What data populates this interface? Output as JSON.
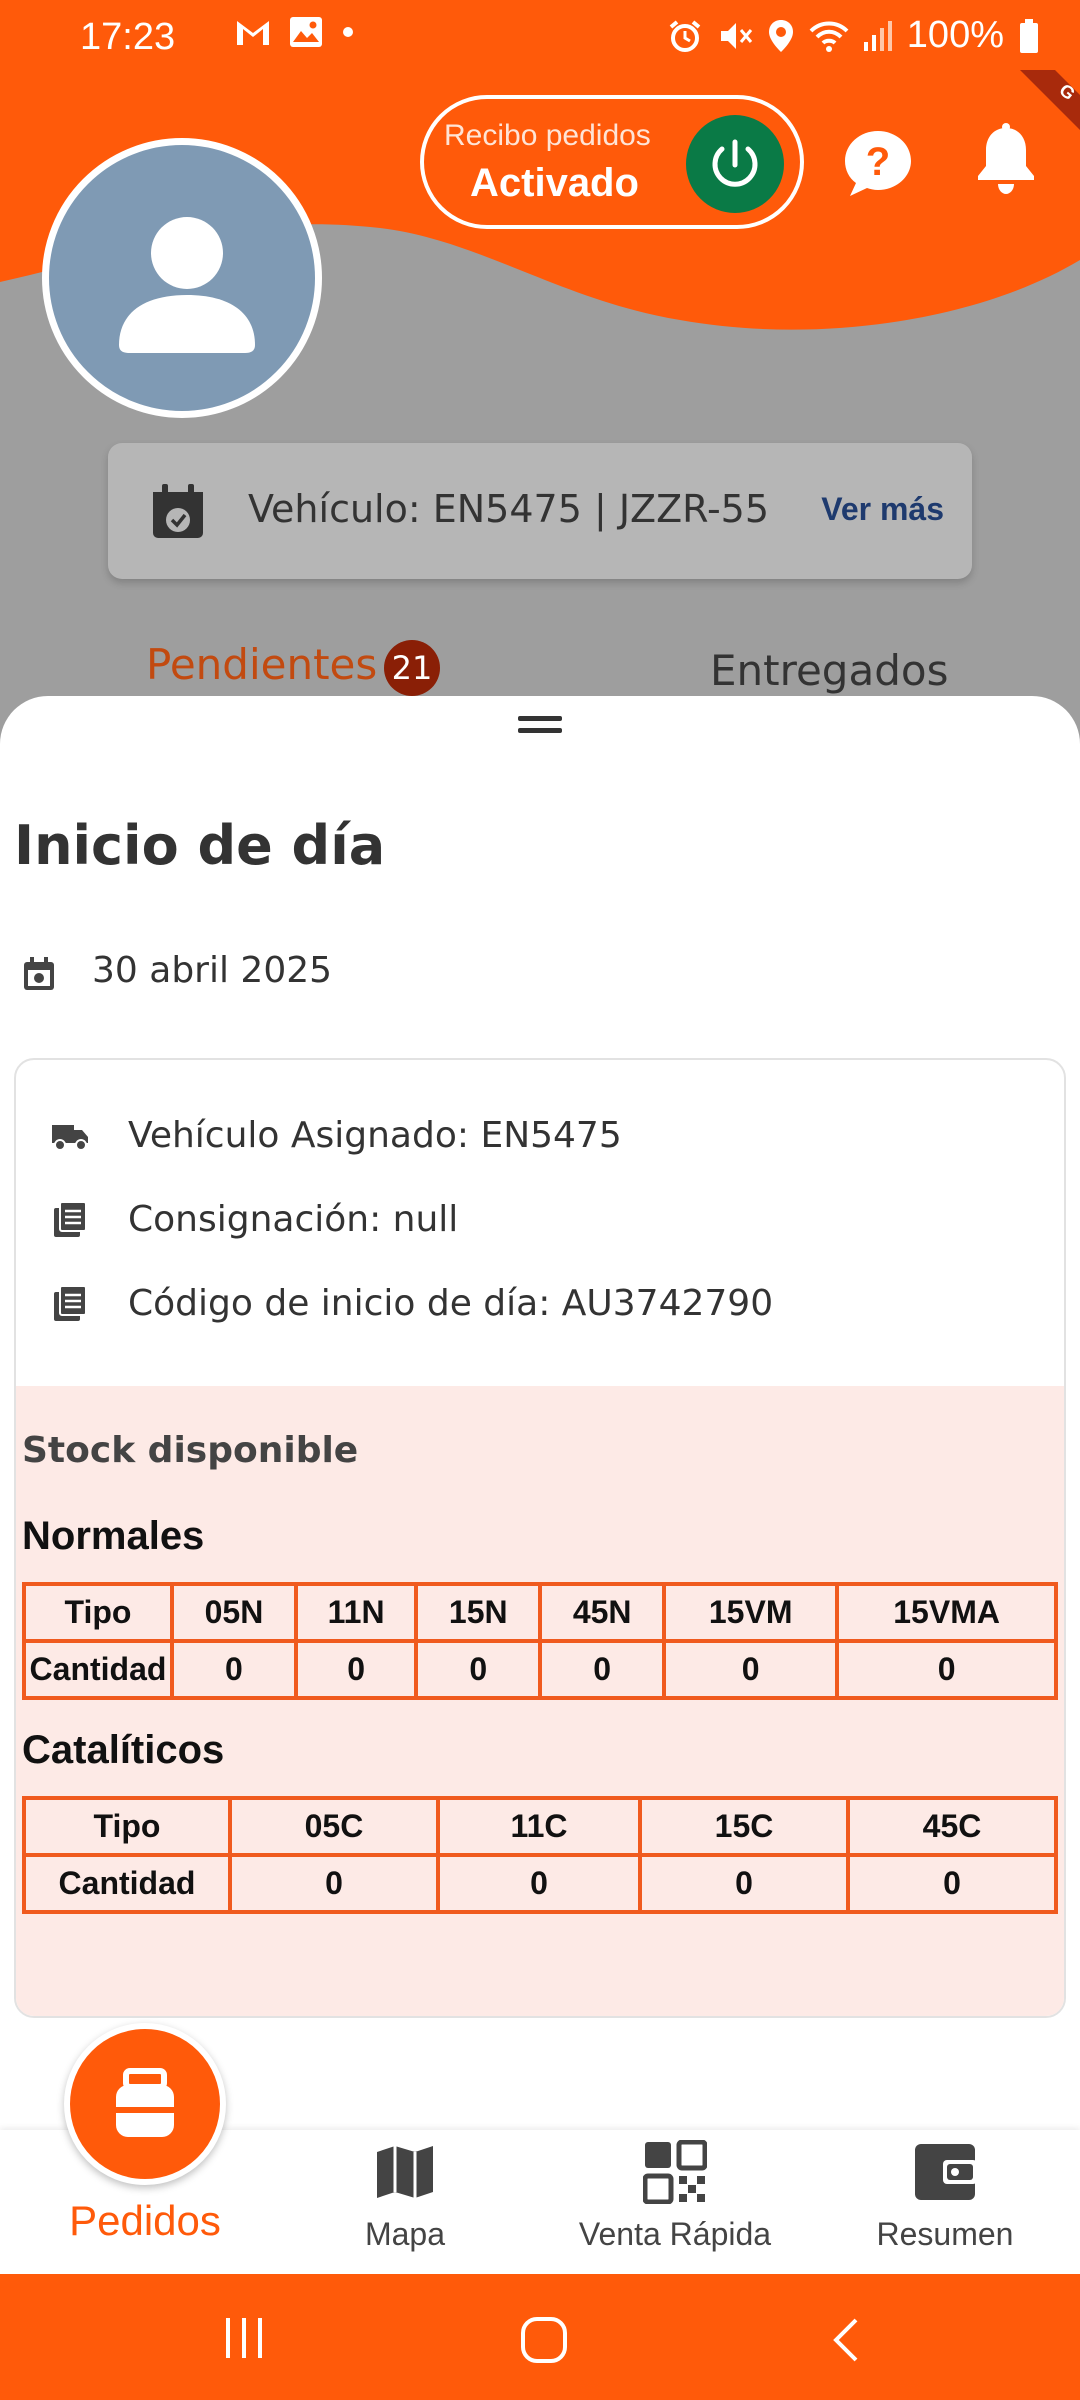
{
  "status_bar": {
    "time": "17:23",
    "battery": "100%",
    "left_icons": [
      "gmail-icon",
      "gallery-icon",
      "dot-icon"
    ],
    "right_icons": [
      "alarm-icon",
      "mute-icon",
      "location-icon",
      "wifi-icon",
      "signal-icon",
      "battery-icon"
    ]
  },
  "header": {
    "recibo_label": "Recibo pedidos",
    "recibo_status": "Activado",
    "ribbon_text": "G"
  },
  "vehicle": {
    "text": "Vehículo: EN5475 | JZZR-55",
    "more_label": "Ver más"
  },
  "tabs": {
    "pending_label": "Pendientes",
    "pending_count": "21",
    "delivered_label": "Entregados"
  },
  "sheet": {
    "title": "Inicio de día",
    "date": "30 abril 2025",
    "info": [
      {
        "icon": "truck-icon",
        "text": "Vehículo Asignado: EN5475"
      },
      {
        "icon": "document-icon",
        "text": "Consignación: null"
      },
      {
        "icon": "document-icon",
        "text": "Código de inicio de día: AU3742790"
      }
    ],
    "stock_title": "Stock disponible",
    "normales": {
      "title": "Normales",
      "header": [
        "Tipo",
        "05N",
        "11N",
        "15N",
        "45N",
        "15VM",
        "15VMA"
      ],
      "row": [
        "Cantidad",
        "0",
        "0",
        "0",
        "0",
        "0",
        "0"
      ]
    },
    "cataliticos": {
      "title": "Catalíticos",
      "header": [
        "Tipo",
        "05C",
        "11C",
        "15C",
        "45C"
      ],
      "row": [
        "Cantidad",
        "0",
        "0",
        "0",
        "0"
      ]
    }
  },
  "bottom_nav": {
    "pedidos": "Pedidos",
    "mapa": "Mapa",
    "venta_rapida": "Venta Rápida",
    "resumen": "Resumen"
  },
  "colors": {
    "brand_orange": "#ff5a0a",
    "power_green": "#0a7a46",
    "badge_red": "#8a1f06",
    "link_blue": "#1e3a6e",
    "stock_bg": "#fdeae6"
  }
}
